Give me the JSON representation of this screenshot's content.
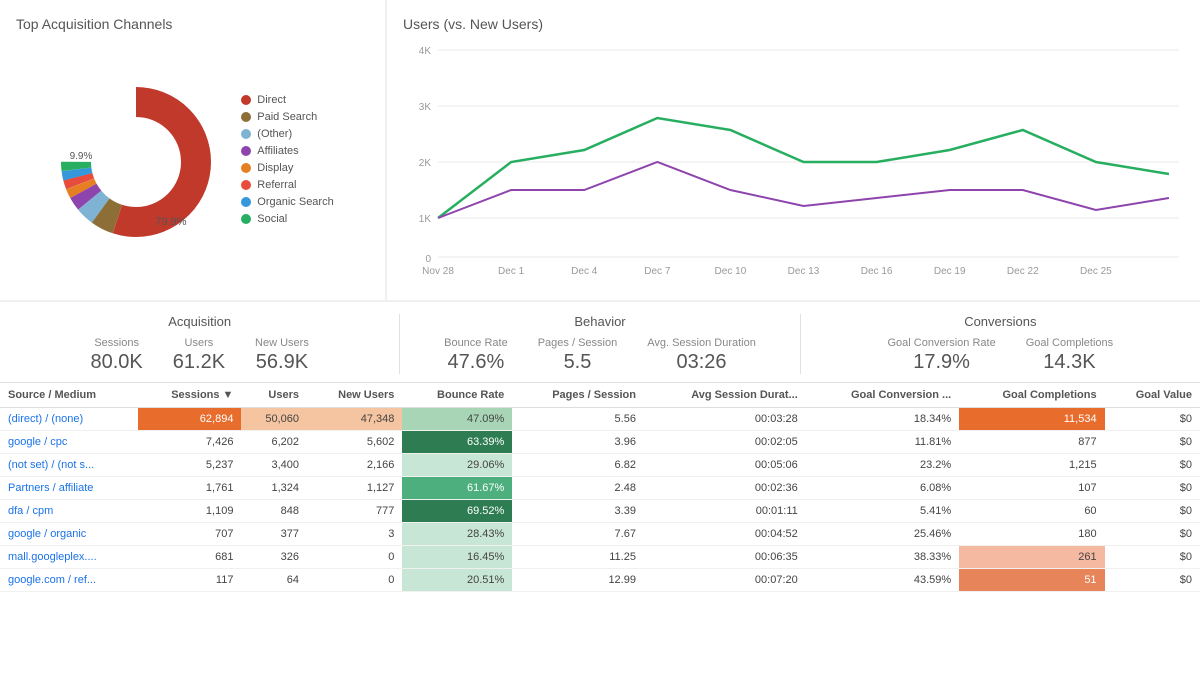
{
  "donut": {
    "title": "Top Acquisition Channels",
    "legend": [
      {
        "label": "Direct",
        "color": "#c0392b"
      },
      {
        "label": "Paid Search",
        "color": "#8d6e36"
      },
      {
        "label": "(Other)",
        "color": "#7fb3d3"
      },
      {
        "label": "Affiliates",
        "color": "#8e44ad"
      },
      {
        "label": "Display",
        "color": "#e67e22"
      },
      {
        "label": "Referral",
        "color": "#c0392b"
      },
      {
        "label": "Organic Search",
        "color": "#3498db"
      },
      {
        "label": "Social",
        "color": "#27ae60"
      }
    ],
    "labels": {
      "outer": "9.9%",
      "inner": "79.9%"
    }
  },
  "lineChart": {
    "title": "Users (vs. New Users)",
    "xLabels": [
      "Nov 28",
      "Dec 1",
      "Dec 4",
      "Dec 7",
      "Dec 10",
      "Dec 13",
      "Dec 16",
      "Dec 19",
      "Dec 22",
      "Dec 25"
    ],
    "yLabels": [
      "0",
      "1K",
      "2K",
      "3K",
      "4K"
    ]
  },
  "metrics": {
    "acquisition": {
      "title": "Acquisition",
      "items": [
        {
          "label": "Sessions",
          "value": "80.0K"
        },
        {
          "label": "Users",
          "value": "61.2K"
        },
        {
          "label": "New Users",
          "value": "56.9K"
        }
      ]
    },
    "behavior": {
      "title": "Behavior",
      "items": [
        {
          "label": "Bounce Rate",
          "value": "47.6%"
        },
        {
          "label": "Pages / Session",
          "value": "5.5"
        },
        {
          "label": "Avg. Session Duration",
          "value": "03:26"
        }
      ]
    },
    "conversions": {
      "title": "Conversions",
      "items": [
        {
          "label": "Goal Conversion Rate",
          "value": "17.9%"
        },
        {
          "label": "Goal Completions",
          "value": "14.3K"
        }
      ]
    }
  },
  "table": {
    "headers": [
      "Source / Medium",
      "Sessions",
      "Users",
      "New Users",
      "Bounce Rate",
      "Pages / Session",
      "Avg Session Durat...",
      "Goal Conversion ...",
      "Goal Completions",
      "Goal Value"
    ],
    "rows": [
      {
        "source": "(direct) / (none)",
        "sessions": "62,894",
        "users": "50,060",
        "newUsers": "47,348",
        "bounceRate": "47.09%",
        "pagesSession": "5.56",
        "avgDuration": "00:03:28",
        "goalConversion": "18.34%",
        "goalCompletions": "11,534",
        "goalValue": "$0",
        "sessionsStyle": "orange",
        "usersStyle": "light-orange",
        "newUsersStyle": "light-orange",
        "bounceStyle": "green-light",
        "goalStyle": "orange"
      },
      {
        "source": "google / cpc",
        "sessions": "7,426",
        "users": "6,202",
        "newUsers": "5,602",
        "bounceRate": "63.39%",
        "pagesSession": "3.96",
        "avgDuration": "00:02:05",
        "goalConversion": "11.81%",
        "goalCompletions": "877",
        "goalValue": "$0",
        "sessionsStyle": "",
        "usersStyle": "",
        "newUsersStyle": "",
        "bounceStyle": "green-dark",
        "goalStyle": ""
      },
      {
        "source": "(not set) / (not s...",
        "sessions": "5,237",
        "users": "3,400",
        "newUsers": "2,166",
        "bounceRate": "29.06%",
        "pagesSession": "6.82",
        "avgDuration": "00:05:06",
        "goalConversion": "23.2%",
        "goalCompletions": "1,215",
        "goalValue": "$0",
        "sessionsStyle": "",
        "usersStyle": "",
        "newUsersStyle": "",
        "bounceStyle": "green-pale",
        "goalStyle": ""
      },
      {
        "source": "Partners / affiliate",
        "sessions": "1,761",
        "users": "1,324",
        "newUsers": "1,127",
        "bounceRate": "61.67%",
        "pagesSession": "2.48",
        "avgDuration": "00:02:36",
        "goalConversion": "6.08%",
        "goalCompletions": "107",
        "goalValue": "$0",
        "sessionsStyle": "",
        "usersStyle": "",
        "newUsersStyle": "",
        "bounceStyle": "green-med",
        "goalStyle": ""
      },
      {
        "source": "dfa / cpm",
        "sessions": "1,109",
        "users": "848",
        "newUsers": "777",
        "bounceRate": "69.52%",
        "pagesSession": "3.39",
        "avgDuration": "00:01:11",
        "goalConversion": "5.41%",
        "goalCompletions": "60",
        "goalValue": "$0",
        "sessionsStyle": "",
        "usersStyle": "",
        "newUsersStyle": "",
        "bounceStyle": "green-dark",
        "goalStyle": ""
      },
      {
        "source": "google / organic",
        "sessions": "707",
        "users": "377",
        "newUsers": "3",
        "bounceRate": "28.43%",
        "pagesSession": "7.67",
        "avgDuration": "00:04:52",
        "goalConversion": "25.46%",
        "goalCompletions": "180",
        "goalValue": "$0",
        "sessionsStyle": "",
        "usersStyle": "",
        "newUsersStyle": "",
        "bounceStyle": "green-pale",
        "goalStyle": ""
      },
      {
        "source": "mall.googleplex....",
        "sessions": "681",
        "users": "326",
        "newUsers": "0",
        "bounceRate": "16.45%",
        "pagesSession": "11.25",
        "avgDuration": "00:06:35",
        "goalConversion": "38.33%",
        "goalCompletions": "261",
        "goalValue": "$0",
        "sessionsStyle": "",
        "usersStyle": "",
        "newUsersStyle": "",
        "bounceStyle": "green-pale",
        "goalStyle": "red-light"
      },
      {
        "source": "google.com / ref...",
        "sessions": "117",
        "users": "64",
        "newUsers": "0",
        "bounceRate": "20.51%",
        "pagesSession": "12.99",
        "avgDuration": "00:07:20",
        "goalConversion": "43.59%",
        "goalCompletions": "51",
        "goalValue": "$0",
        "sessionsStyle": "",
        "usersStyle": "",
        "newUsersStyle": "",
        "bounceStyle": "green-pale",
        "goalStyle": "red-med"
      }
    ]
  }
}
